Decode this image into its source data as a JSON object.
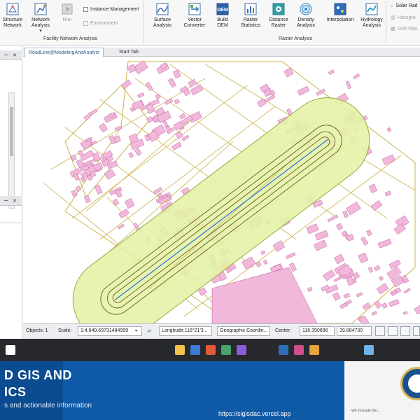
{
  "ribbon": {
    "items": [
      {
        "label": "Structure",
        "label2": "Network"
      },
      {
        "label": "Network",
        "label2": "Analysis",
        "dd": "▾"
      },
      {
        "label": "Run",
        "label2": ""
      },
      {
        "label": "Surface",
        "label2": "Analysis",
        "dd": "▾"
      },
      {
        "label": "Vector",
        "label2": "Converter",
        "dd": "▾"
      },
      {
        "label": "Build",
        "label2": "DEM",
        "dd": "▾"
      },
      {
        "label": "Raster",
        "label2": "Statistics",
        "dd": "▾"
      },
      {
        "label": "Distance",
        "label2": "Raster",
        "dd": "▾"
      },
      {
        "label": "Density",
        "label2": "Analysis",
        "dd": "▾"
      },
      {
        "label": "Interpolation",
        "label2": ""
      },
      {
        "label": "Hydrology",
        "label2": "Analysis",
        "dd": "▾"
      }
    ],
    "instance_management": "Instance Management",
    "environment": "Environment",
    "group_facility": "Facility Network Analysis",
    "group_raster": "Raster Analysis",
    "solar_rad": "Solar Rad",
    "histogram": "Histogra",
    "grid_value": "Grid Valu",
    "dem_icon_text": "DEM",
    "accent": "#2f6db5"
  },
  "tabs": [
    {
      "label": "RoadLine@ModelingAndAnalyst",
      "close": "×"
    },
    {
      "label": "Start Tab"
    }
  ],
  "dock": {
    "pin": "ꟷ",
    "close": "✕",
    "pin2": "ꟷ",
    "close2": "✕"
  },
  "status": {
    "objects": "Objects: 1",
    "scale_label": "Scale:",
    "scale_value": "1:4,649.69731484999",
    "longitude": "Longitude:116°21'3...",
    "coord_system": "Geographic Coordin...",
    "center_label": "Center:",
    "center_x": "116.350896",
    "center_y": "39.884730"
  },
  "banner": {
    "title_line1": "D GIS AND",
    "title_line2": "ICS",
    "subtitle": "s and actionable information",
    "url": "https://sigisdac.vercel.app",
    "seal_text": "We Innovate We..."
  },
  "colors": {
    "buffer_fill": "#e4f2a6",
    "buffer_stroke": "#9aa93e",
    "road": "#c9b24a",
    "building": "#f2b8dc",
    "building_stroke": "#b5578f",
    "centerline": "#2c6fd0",
    "banner": "#0f5aa6"
  }
}
